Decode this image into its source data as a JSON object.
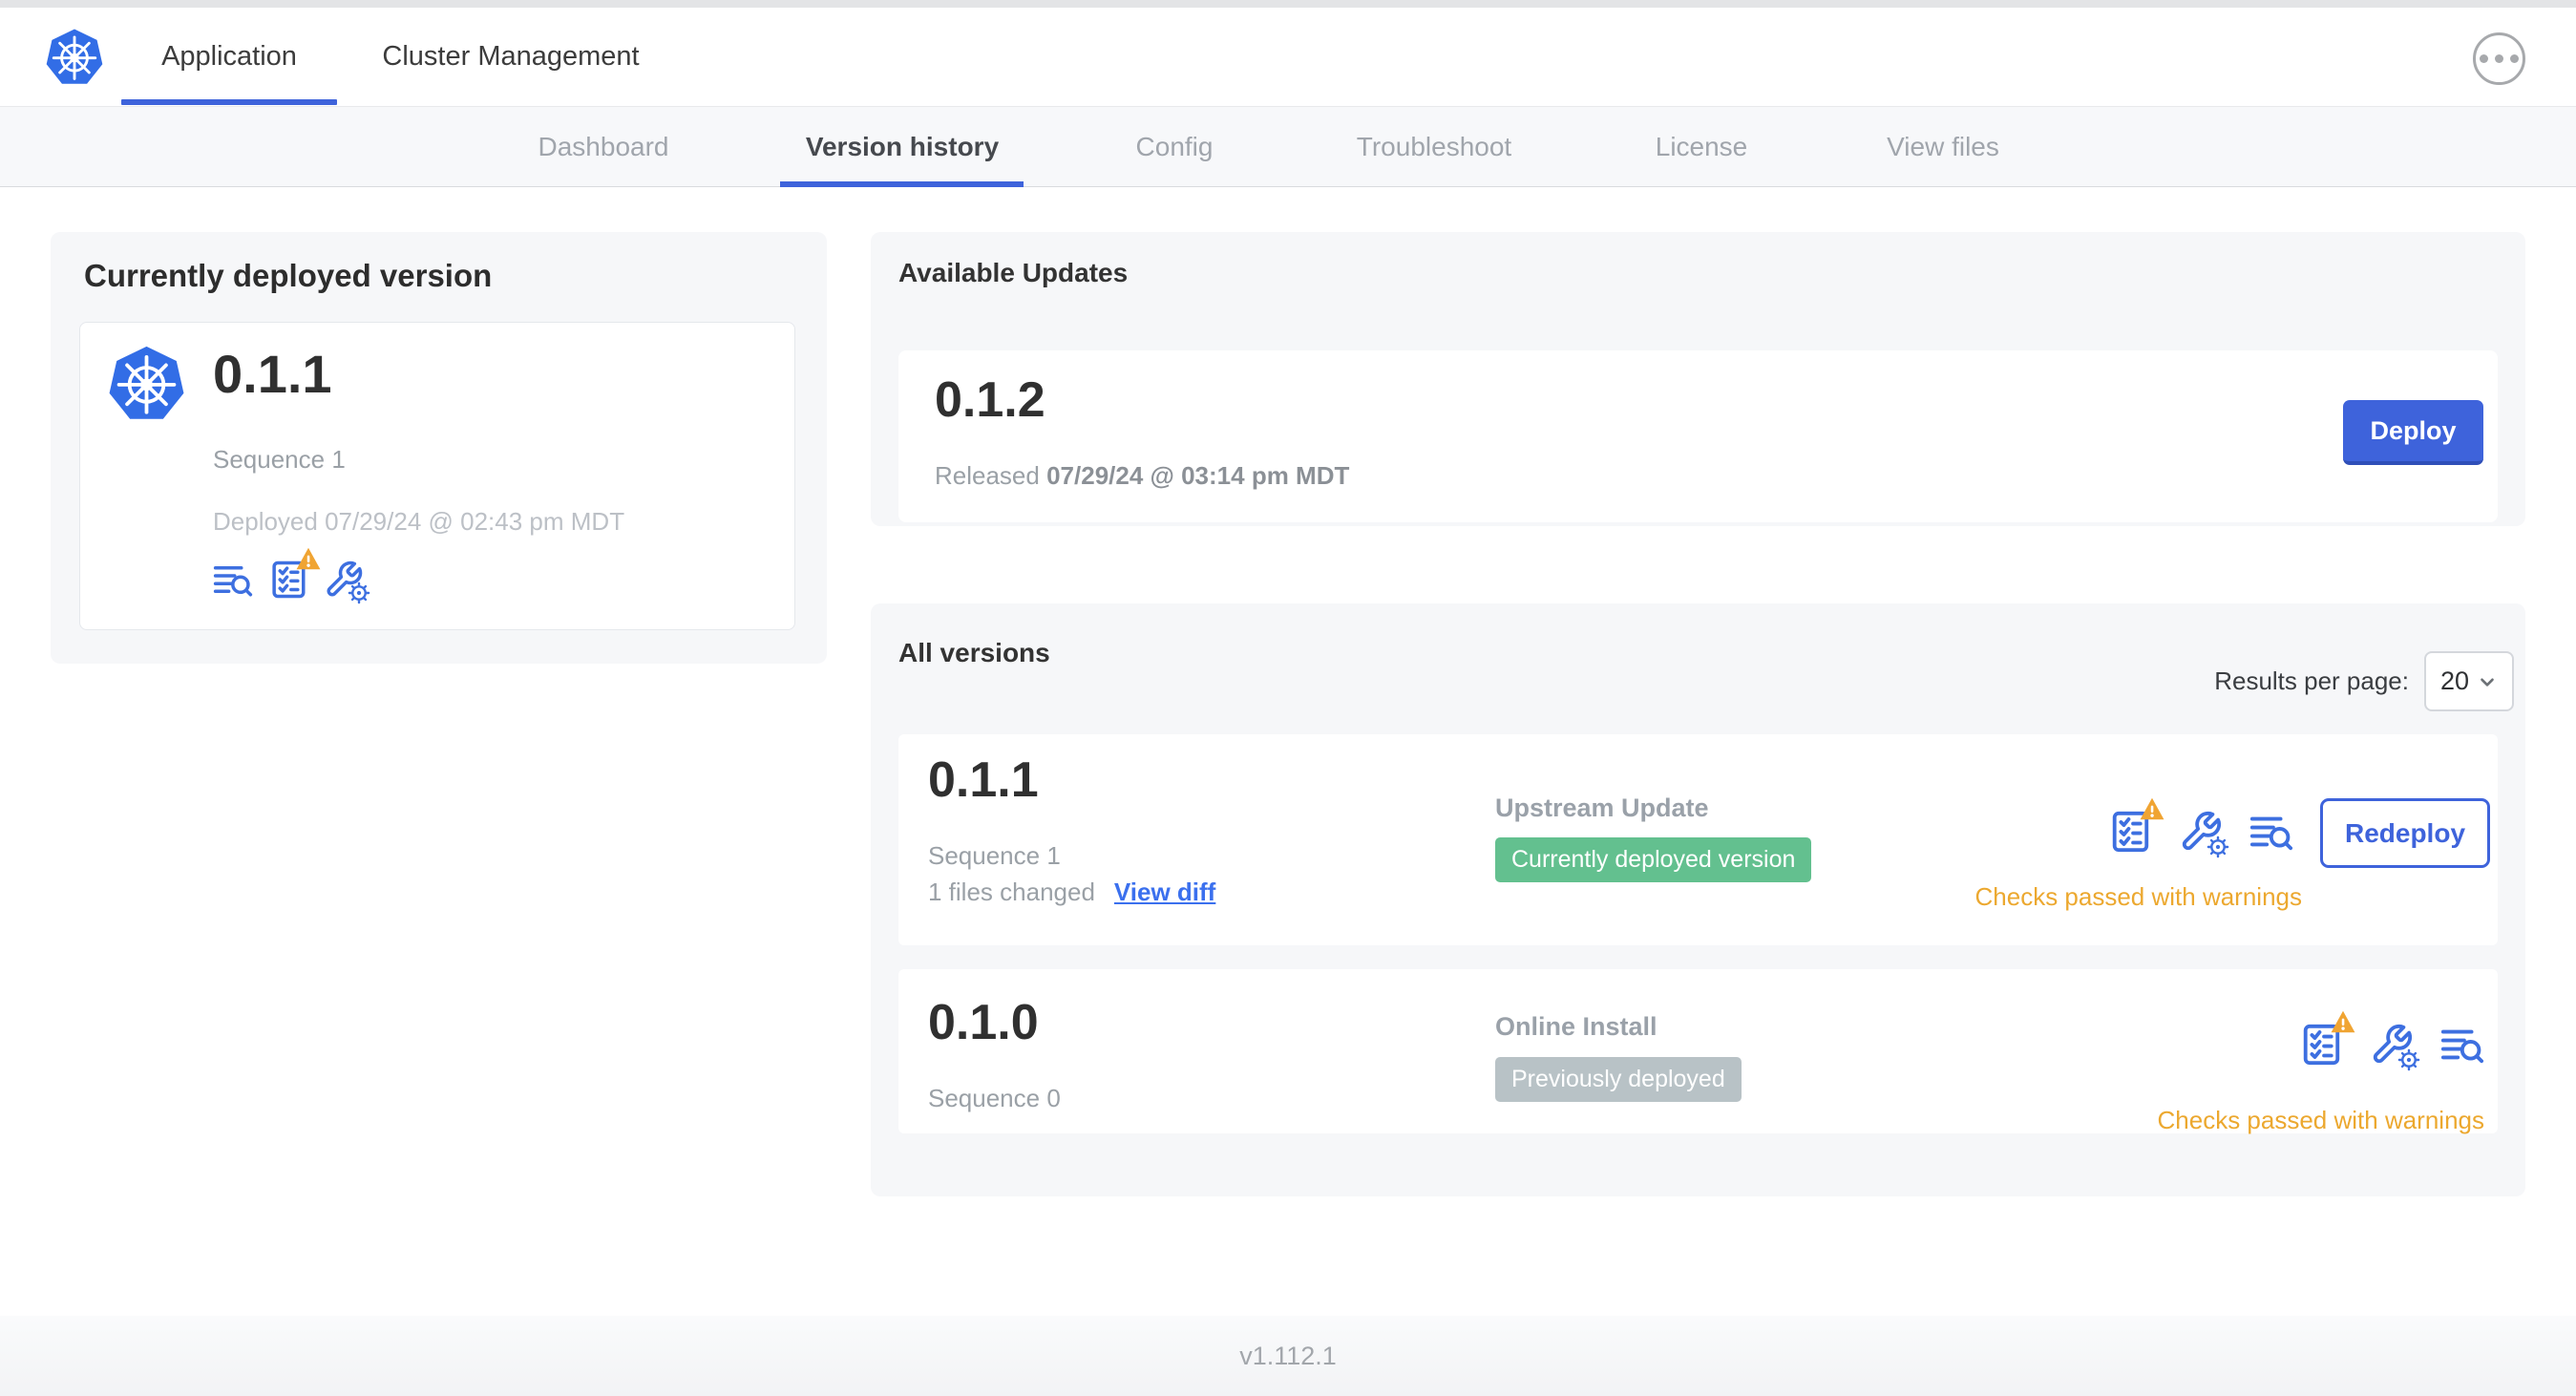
{
  "colors": {
    "accent_blue": "#3E63DB",
    "icon_blue": "#3D6FE0",
    "link_blue": "#3B70EE",
    "k8s_blue": "#326DE6",
    "badge_green": "#63C08F",
    "badge_gray": "#B8C2C6",
    "warning_orange": "#ECA82F"
  },
  "header": {
    "tabs": [
      "Application",
      "Cluster Management"
    ],
    "more_menu_icon": "ellipsis-icon"
  },
  "subnav": {
    "tabs": [
      "Dashboard",
      "Version history",
      "Config",
      "Troubleshoot",
      "License",
      "View files"
    ],
    "active_tab": "Version history"
  },
  "currently_deployed": {
    "title": "Currently deployed version",
    "version": "0.1.1",
    "sequence": "Sequence 1",
    "deployed_at": "Deployed 07/29/24 @ 02:43 pm MDT",
    "icons": [
      "logs-icon",
      "preflight-checks-warning-icon",
      "config-icon"
    ]
  },
  "available_updates": {
    "title": "Available Updates",
    "version": "0.1.2",
    "released_label": "Released",
    "released_at": "07/29/24 @ 03:14 pm MDT",
    "deploy_button": "Deploy"
  },
  "all_versions": {
    "title": "All versions",
    "results_per_page_label": "Results per page:",
    "results_per_page_value": "20",
    "rows": [
      {
        "version": "0.1.1",
        "sequence": "Sequence 1",
        "files_changed": "1 files changed",
        "view_diff_link": "View diff",
        "source": "Upstream Update",
        "status_badge": "Currently deployed version",
        "badge_color": "green",
        "checks_status": "Checks passed with warnings",
        "action_button": "Redeploy",
        "icons": [
          "preflight-checks-warning-icon",
          "config-icon",
          "logs-icon"
        ]
      },
      {
        "version": "0.1.0",
        "sequence": "Sequence 0",
        "source": "Online Install",
        "status_badge": "Previously deployed",
        "badge_color": "gray",
        "checks_status": "Checks passed with warnings",
        "icons": [
          "preflight-checks-warning-icon",
          "config-icon",
          "logs-icon"
        ]
      }
    ]
  },
  "footer": {
    "app_version": "v1.112.1"
  }
}
